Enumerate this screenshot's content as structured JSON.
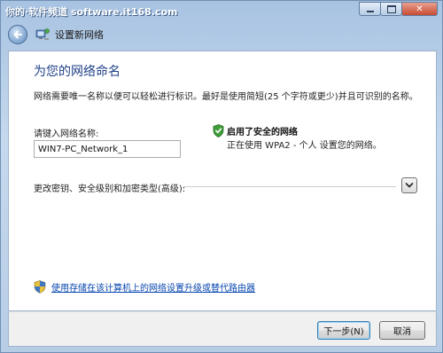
{
  "watermark": {
    "text": "你的·软件频道 software.it168.com"
  },
  "window": {
    "title": "设置新网络",
    "controls": {
      "minimize_icon": "minimize-icon",
      "maximize_icon": "maximize-icon",
      "close_glyph": "✕"
    }
  },
  "page": {
    "heading": "为您的网络命名",
    "description": "网络需要唯一名称以便可以轻松进行标识。最好是使用简短(25 个字符或更少)并且可识别的名称。"
  },
  "network_name": {
    "label": "请键入网络名称:",
    "value": "WIN7-PC_Network_1"
  },
  "security": {
    "icon": "shield-check-icon",
    "title": "启用了安全的网络",
    "description": "正在使用 WPA2 - 个人 设置您的网络。"
  },
  "advanced": {
    "label": "更改密钥、安全级别和加密类型(高级):",
    "expand_icon": "chevron-down-icon"
  },
  "upgrade_link": {
    "icon": "shield-icon",
    "text": "使用存储在该计算机上的网络设置升级或替代路由器"
  },
  "footer": {
    "next_label": "下一步(N)",
    "cancel_label": "取消"
  },
  "colors": {
    "heading": "#1e3f87",
    "link": "#0645ad",
    "shield_green": "#3f9f3a"
  }
}
